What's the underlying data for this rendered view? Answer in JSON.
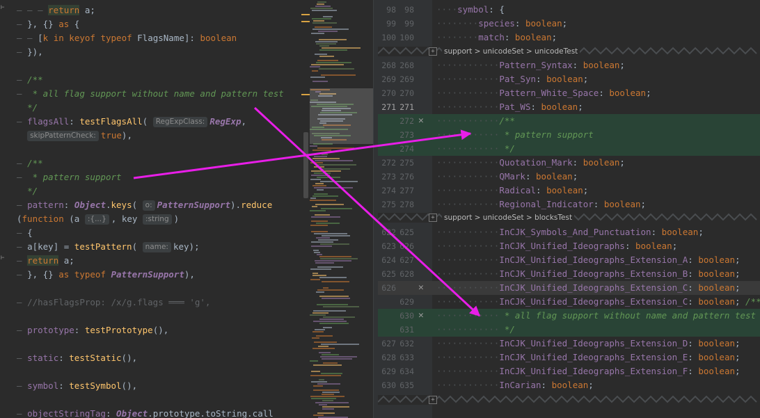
{
  "left_editor": {
    "lines": [
      {
        "indent": "— — — ",
        "parts": [
          {
            "c": "kw retbg",
            "t": "return"
          },
          {
            "c": "",
            "t": " a;"
          }
        ]
      },
      {
        "indent": "— ",
        "parts": [
          {
            "c": "",
            "t": "}, {} "
          },
          {
            "c": "kw",
            "t": "as"
          },
          {
            "c": "",
            "t": " {"
          }
        ]
      },
      {
        "indent": "— — ",
        "parts": [
          {
            "c": "",
            "t": "["
          },
          {
            "c": "kw",
            "t": "k"
          },
          {
            "c": "",
            "t": " "
          },
          {
            "c": "kw",
            "t": "in"
          },
          {
            "c": "",
            "t": " "
          },
          {
            "c": "kw",
            "t": "keyof"
          },
          {
            "c": "",
            "t": " "
          },
          {
            "c": "kw",
            "t": "typeof"
          },
          {
            "c": "",
            "t": " FlagsName]: "
          },
          {
            "c": "kw",
            "t": "boolean"
          }
        ]
      },
      {
        "indent": "— ",
        "parts": [
          {
            "c": "",
            "t": "}),"
          }
        ]
      },
      {
        "indent": "",
        "parts": []
      },
      {
        "indent": "— ",
        "parts": [
          {
            "c": "cm",
            "t": "/**"
          }
        ]
      },
      {
        "indent": "— ",
        "parts": [
          {
            "c": "cm",
            "t": " * all flag support without name and pattern test"
          }
        ]
      },
      {
        "indent": "  ",
        "parts": [
          {
            "c": "cm",
            "t": "*/"
          }
        ]
      },
      {
        "indent": "— ",
        "parts": [
          {
            "c": "prop",
            "t": "flagsAll"
          },
          {
            "c": "",
            "t": ": "
          },
          {
            "c": "fn",
            "t": "testFlagsAll"
          },
          {
            "c": "",
            "t": "( "
          },
          {
            "c": "hint",
            "t": "RegExpClass:"
          },
          {
            "c": "typ",
            "t": "RegExp"
          },
          {
            "c": "",
            "t": ","
          }
        ]
      },
      {
        "indent": "  ",
        "parts": [
          {
            "c": "hint",
            "t": "skipPatternCheck:"
          },
          {
            "c": "kw",
            "t": "true"
          },
          {
            "c": "",
            "t": "),"
          }
        ]
      },
      {
        "indent": "",
        "parts": []
      },
      {
        "indent": "— ",
        "parts": [
          {
            "c": "cm",
            "t": "/**"
          }
        ]
      },
      {
        "indent": "— ",
        "parts": [
          {
            "c": "cm",
            "t": " * pattern support"
          }
        ]
      },
      {
        "indent": "  ",
        "parts": [
          {
            "c": "cm",
            "t": "*/"
          }
        ]
      },
      {
        "indent": "— ",
        "parts": [
          {
            "c": "prop",
            "t": "pattern"
          },
          {
            "c": "",
            "t": ": "
          },
          {
            "c": "typ",
            "t": "Object"
          },
          {
            "c": "",
            "t": "."
          },
          {
            "c": "fn",
            "t": "keys"
          },
          {
            "c": "",
            "t": "( "
          },
          {
            "c": "hint",
            "t": "o:"
          },
          {
            "c": "typ",
            "t": "PatternSupport"
          },
          {
            "c": "",
            "t": ")."
          },
          {
            "c": "fn",
            "t": "reduce"
          }
        ]
      },
      {
        "indent": "",
        "parts": [
          {
            "c": "",
            "t": "("
          },
          {
            "c": "kw",
            "t": "function"
          },
          {
            "c": "",
            "t": " (a "
          },
          {
            "c": "hint",
            "t": ":{...}"
          },
          {
            "c": "",
            "t": ", key "
          },
          {
            "c": "hint",
            "t": ":string"
          },
          {
            "c": "",
            "t": ")"
          }
        ]
      },
      {
        "indent": "— ",
        "parts": [
          {
            "c": "",
            "t": "{"
          }
        ]
      },
      {
        "indent": "— ",
        "parts": [
          {
            "c": "",
            "t": "a[key] = "
          },
          {
            "c": "fn",
            "t": "testPattern"
          },
          {
            "c": "",
            "t": "( "
          },
          {
            "c": "hint",
            "t": "name:"
          },
          {
            "c": "",
            "t": "key);"
          }
        ]
      },
      {
        "indent": "— ",
        "parts": [
          {
            "c": "kw retbg",
            "t": "return"
          },
          {
            "c": "",
            "t": " a;"
          }
        ]
      },
      {
        "indent": "— ",
        "parts": [
          {
            "c": "",
            "t": "}, {} "
          },
          {
            "c": "kw",
            "t": "as"
          },
          {
            "c": "",
            "t": " "
          },
          {
            "c": "kw",
            "t": "typeof"
          },
          {
            "c": "",
            "t": " "
          },
          {
            "c": "typ",
            "t": "PatternSupport"
          },
          {
            "c": "",
            "t": "),"
          }
        ]
      },
      {
        "indent": "",
        "parts": []
      },
      {
        "indent": "— ",
        "parts": [
          {
            "c": "g",
            "t": "//hasFlagsProp: /x/g.flags ═══ 'g',"
          }
        ]
      },
      {
        "indent": "",
        "parts": []
      },
      {
        "indent": "— ",
        "parts": [
          {
            "c": "prop",
            "t": "prototype"
          },
          {
            "c": "",
            "t": ": "
          },
          {
            "c": "fn",
            "t": "testPrototype"
          },
          {
            "c": "",
            "t": "(),"
          }
        ]
      },
      {
        "indent": "",
        "parts": []
      },
      {
        "indent": "— ",
        "parts": [
          {
            "c": "prop",
            "t": "static"
          },
          {
            "c": "",
            "t": ": "
          },
          {
            "c": "fn",
            "t": "testStatic"
          },
          {
            "c": "",
            "t": "(),"
          }
        ]
      },
      {
        "indent": "",
        "parts": []
      },
      {
        "indent": "— ",
        "parts": [
          {
            "c": "prop",
            "t": "symbol"
          },
          {
            "c": "",
            "t": ": "
          },
          {
            "c": "fn",
            "t": "testSymbol"
          },
          {
            "c": "",
            "t": "(),"
          }
        ]
      },
      {
        "indent": "",
        "parts": []
      },
      {
        "indent": "— ",
        "parts": [
          {
            "c": "prop",
            "t": "objectStringTag"
          },
          {
            "c": "",
            "t": ": "
          },
          {
            "c": "typ",
            "t": "Object"
          },
          {
            "c": "",
            "t": ".prototype.toString.call"
          }
        ]
      }
    ]
  },
  "diff_view": {
    "collapsed_sections": [
      "support > unicodeSet > unicodeTest",
      "support > unicodeSet > blocksTest"
    ],
    "block1": [
      {
        "l": "98",
        "r": "98",
        "code": "symbol: {",
        "ind": "····",
        "type": "same"
      },
      {
        "l": "99",
        "r": "99",
        "code": "species: boolean;",
        "ind": "········",
        "type": "same"
      },
      {
        "l": "100",
        "r": "100",
        "code": "match: boolean;",
        "ind": "········",
        "type": "same"
      }
    ],
    "block2": [
      {
        "l": "268",
        "r": "268",
        "code": "Pattern_Syntax: boolean;",
        "ind": "············",
        "type": "same"
      },
      {
        "l": "269",
        "r": "269",
        "code": "Pat_Syn: boolean;",
        "ind": "············",
        "type": "same"
      },
      {
        "l": "270",
        "r": "270",
        "code": "Pattern_White_Space: boolean;",
        "ind": "············",
        "type": "same"
      },
      {
        "l": "271",
        "r": "271",
        "code": "Pat_WS: boolean;",
        "ind": "············",
        "type": "cur"
      },
      {
        "l": "",
        "r": "272",
        "code": "/**",
        "ind": "············",
        "type": "added",
        "x": true
      },
      {
        "l": "",
        "r": "273",
        "code": " * pattern support",
        "ind": "············",
        "type": "added"
      },
      {
        "l": "",
        "r": "274",
        "code": " */",
        "ind": "············",
        "type": "added"
      },
      {
        "l": "272",
        "r": "275",
        "code": "Quotation_Mark: boolean;",
        "ind": "············",
        "type": "same"
      },
      {
        "l": "273",
        "r": "276",
        "code": "QMark: boolean;",
        "ind": "············",
        "type": "same"
      },
      {
        "l": "274",
        "r": "277",
        "code": "Radical: boolean;",
        "ind": "············",
        "type": "same"
      },
      {
        "l": "275",
        "r": "278",
        "code": "Regional_Indicator: boolean;",
        "ind": "············",
        "type": "same"
      }
    ],
    "block3": [
      {
        "l": "622",
        "r": "625",
        "code": "InCJK_Symbols_And_Punctuation: boolean;",
        "ind": "············",
        "type": "same"
      },
      {
        "l": "623",
        "r": "626",
        "code": "InCJK_Unified_Ideographs: boolean;",
        "ind": "············",
        "type": "same"
      },
      {
        "l": "624",
        "r": "627",
        "code": "InCJK_Unified_Ideographs_Extension_A: boolean;",
        "ind": "············",
        "type": "same"
      },
      {
        "l": "625",
        "r": "628",
        "code": "InCJK_Unified_Ideographs_Extension_B: boolean;",
        "ind": "············",
        "type": "same"
      },
      {
        "l": "626",
        "r": "",
        "code": "InCJK_Unified_Ideographs_Extension_C: boolean;",
        "ind": "············",
        "type": "changed",
        "x": true
      },
      {
        "l": "",
        "r": "629",
        "code": "InCJK_Unified_Ideographs_Extension_C: boolean; /**",
        "ind": "············",
        "type": "same"
      },
      {
        "l": "",
        "r": "630",
        "code": " * all flag support without name and pattern test",
        "ind": "············",
        "type": "added",
        "x": true
      },
      {
        "l": "",
        "r": "631",
        "code": " */",
        "ind": "············",
        "type": "added"
      },
      {
        "l": "627",
        "r": "632",
        "code": "InCJK_Unified_Ideographs_Extension_D: boolean;",
        "ind": "············",
        "type": "same"
      },
      {
        "l": "628",
        "r": "633",
        "code": "InCJK_Unified_Ideographs_Extension_E: boolean;",
        "ind": "············",
        "type": "same"
      },
      {
        "l": "629",
        "r": "634",
        "code": "InCJK_Unified_Ideographs_Extension_F: boolean;",
        "ind": "············",
        "type": "same"
      },
      {
        "l": "630",
        "r": "635",
        "code": "InCarian: boolean;",
        "ind": "············",
        "type": "same"
      }
    ]
  },
  "colors": {
    "arrow": "#e81ee8",
    "added_bg": "#294436",
    "comment": "#629755",
    "keyword": "#cc7832"
  },
  "icons": {
    "expand": "plus-icon",
    "dismiss": "close-icon"
  }
}
